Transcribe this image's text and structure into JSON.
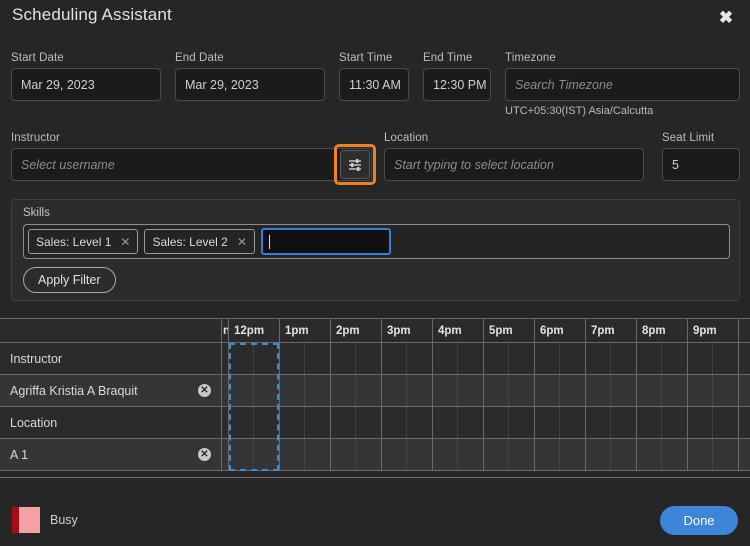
{
  "dialog": {
    "title": "Scheduling Assistant",
    "close_icon": "close-icon"
  },
  "form": {
    "start_date": {
      "label": "Start Date",
      "value": "Mar 29, 2023"
    },
    "end_date": {
      "label": "End Date",
      "value": "Mar 29, 2023"
    },
    "start_time": {
      "label": "Start Time",
      "value": "11:30 AM"
    },
    "end_time": {
      "label": "End Time",
      "value": "12:30 PM"
    },
    "timezone": {
      "label": "Timezone",
      "placeholder": "Search Timezone",
      "value": "",
      "note": "UTC+05:30(IST) Asia/Calcutta"
    },
    "instructor": {
      "label": "Instructor",
      "placeholder": "Select username",
      "value": "",
      "filter_icon": "sliders-filter-icon",
      "filter_highlight_color": "#ef8023"
    },
    "location": {
      "label": "Location",
      "placeholder": "Start typing to select location",
      "value": ""
    },
    "seat_limit": {
      "label": "Seat Limit",
      "value": "5"
    }
  },
  "skills": {
    "label": "Skills",
    "chips": [
      {
        "label": "Sales: Level 1",
        "remove_icon": "close-icon"
      },
      {
        "label": "Sales: Level 2",
        "remove_icon": "close-icon"
      }
    ],
    "entry_placeholder": "",
    "entry_value": "",
    "entry_focus_color": "#2f7fd8",
    "apply_filter_label": "Apply Filter"
  },
  "timeline": {
    "columns": [
      "n",
      "12pm",
      "1pm",
      "2pm",
      "3pm",
      "4pm",
      "5pm",
      "6pm",
      "7pm",
      "8pm",
      "9pm"
    ],
    "rows": [
      {
        "label": "Instructor",
        "removable": false,
        "shade": "dark"
      },
      {
        "label": "Agriffa Kristia A Braquit",
        "removable": true,
        "remove_icon": "close-circle-icon",
        "shade": "light"
      },
      {
        "label": "Location",
        "removable": false,
        "shade": "dark"
      },
      {
        "label": "A 1",
        "removable": true,
        "remove_icon": "close-circle-icon",
        "shade": "light"
      }
    ],
    "selection": {
      "start_label": "11:30 AM",
      "end_label": "12:30 PM",
      "color": "#2f8fe0"
    }
  },
  "footer": {
    "legend": {
      "label": "Busy",
      "fill_color": "#f3a3a7",
      "edge_color": "#a80d12"
    },
    "done_label": "Done",
    "done_color": "#3d85d8"
  }
}
